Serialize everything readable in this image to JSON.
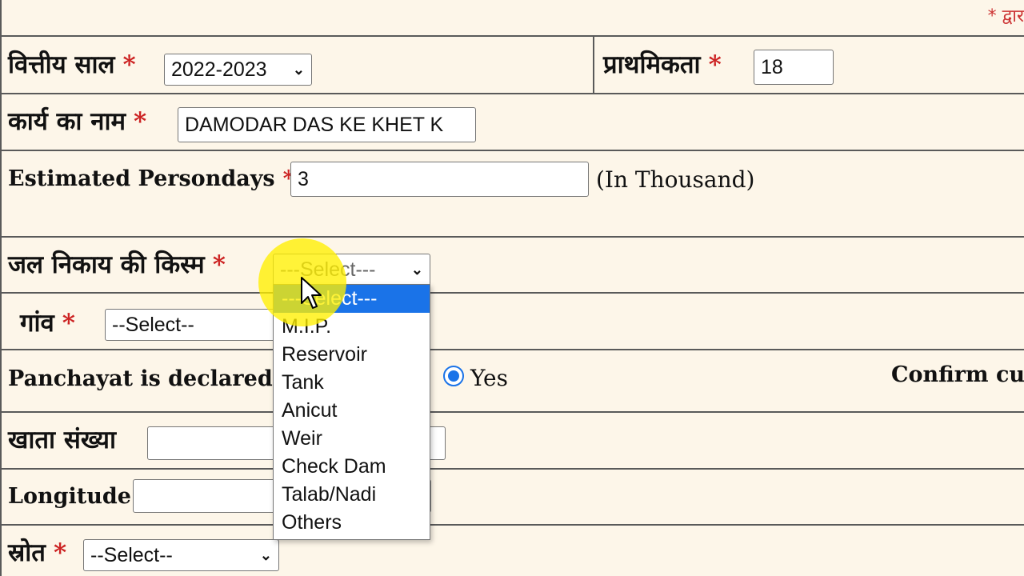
{
  "top_note": "* द्वार",
  "financial_year": {
    "label": "वित्तीय साल",
    "required": "*",
    "value": "2022-2023"
  },
  "priority": {
    "label": "प्राथमिकता",
    "required": "*",
    "value": "18"
  },
  "work_name": {
    "label": "कार्य का नाम",
    "required": "*",
    "value": "DAMODAR DAS KE KHET K"
  },
  "persondays": {
    "label": "Estimated Persondays",
    "required": "*",
    "value": "3",
    "unit": "(In Thousand)"
  },
  "water_body_type": {
    "label": "जल निकाय की किस्म",
    "required": "*",
    "value": "---Select---",
    "options": [
      "---Select---",
      "M.I.P.",
      "Reservoir",
      "Tank",
      "Anicut",
      "Weir",
      "Check Dam",
      "Talab/Nadi",
      "Others"
    ],
    "selected_index": 0
  },
  "village": {
    "label": "गांव",
    "required": "*",
    "value": "--Select--"
  },
  "panchayat": {
    "label": "Panchayat is declared f",
    "yes_label": "Yes",
    "confirm_label": "Confirm cu"
  },
  "account_number": {
    "label": "खाता संख्या",
    "value": ""
  },
  "longitude": {
    "label": "Longitude",
    "value": ""
  },
  "source": {
    "label": "स्रोत",
    "required": "*",
    "value": "--Select--"
  },
  "colors": {
    "background": "#fdf6e9",
    "required": "#cc2222",
    "selected": "#1a73e8",
    "highlight": "#fff000"
  },
  "icons": {
    "select_chevron": "chevron-down-icon",
    "cursor": "mouse-pointer-icon",
    "radio": "radio-checked-icon"
  }
}
